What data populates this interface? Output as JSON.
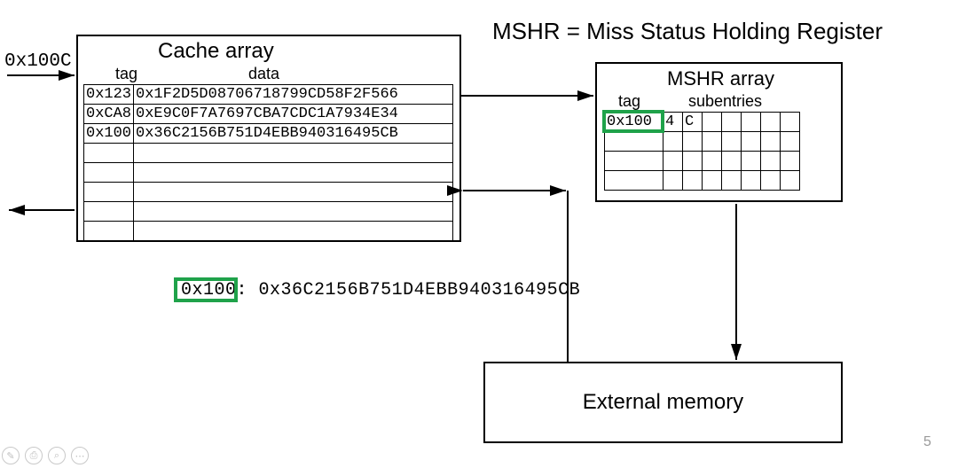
{
  "top_definition": "MSHR = Miss Status Holding Register",
  "address_in": "0x100C",
  "cache": {
    "title": "Cache array",
    "headers": {
      "tag": "tag",
      "data": "data"
    },
    "rows": [
      {
        "tag": "0x123",
        "data": "0x1F2D5D08706718799CD58F2F566"
      },
      {
        "tag": "0xCA8",
        "data": "0xE9C0F7A7697CBA7CDC1A7934E34"
      },
      {
        "tag": "0x100",
        "data": "0x36C2156B751D4EBB940316495CB"
      }
    ]
  },
  "mshr": {
    "title": "MSHR array",
    "headers": {
      "tag": "tag",
      "subentries": "subentries"
    },
    "rows": [
      {
        "tag": "0x100",
        "sub": [
          "4",
          "C",
          "",
          "",
          "",
          "",
          ""
        ]
      },
      {
        "tag": "",
        "sub": [
          "",
          "",
          "",
          "",
          "",
          "",
          ""
        ]
      },
      {
        "tag": "",
        "sub": [
          "",
          "",
          "",
          "",
          "",
          "",
          ""
        ]
      },
      {
        "tag": "",
        "sub": [
          "",
          "",
          "",
          "",
          "",
          "",
          ""
        ]
      }
    ]
  },
  "mem_line": {
    "tag": "0x100",
    "sep": ":",
    "data": "0x36C2156B751D4EBB940316495CB"
  },
  "external_memory_label": "External memory",
  "slide_number": "5",
  "toolbar": {
    "pen": "✎",
    "print": "⎙",
    "search": "⌕",
    "more": "⋯"
  }
}
